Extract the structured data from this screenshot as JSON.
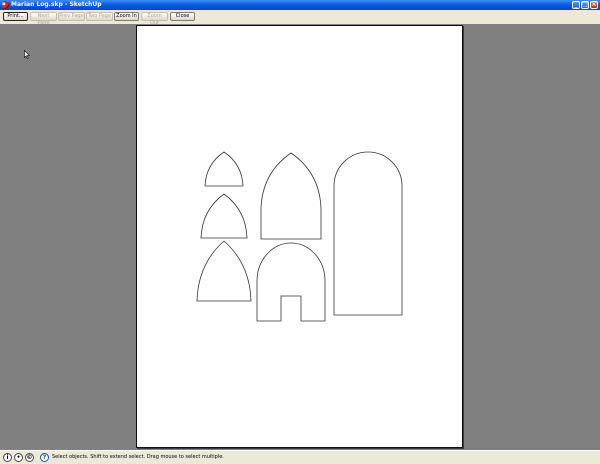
{
  "window": {
    "title": "Marian Log.skp - SketchUp",
    "minimize_glyph": "_",
    "maximize_glyph": "□",
    "close_glyph": "×"
  },
  "toolbar": {
    "print_label": "Print...",
    "next_page_label": "Next Page",
    "prev_page_label": "Prev Page",
    "two_page_label": "Two Page",
    "zoom_in_label": "Zoom In",
    "zoom_out_label": "Zoom Out",
    "close_label": "Close"
  },
  "statusbar": {
    "help_glyph": "?",
    "message": "Select objects. Shift to extend select. Drag mouse to select multiple."
  },
  "colors": {
    "title_bar": "#0a5fe0",
    "preview_background": "#808080",
    "paper": "#ffffff",
    "chrome": "#ece9d8",
    "shape_stroke": "#333333"
  },
  "icons": {
    "app": "sketchup-app-icon",
    "cursor": "arrow-cursor-icon",
    "status_1": "user-info-icon",
    "status_2": "geolocation-icon",
    "status_3": "credits-icon",
    "status_help": "help-icon"
  }
}
